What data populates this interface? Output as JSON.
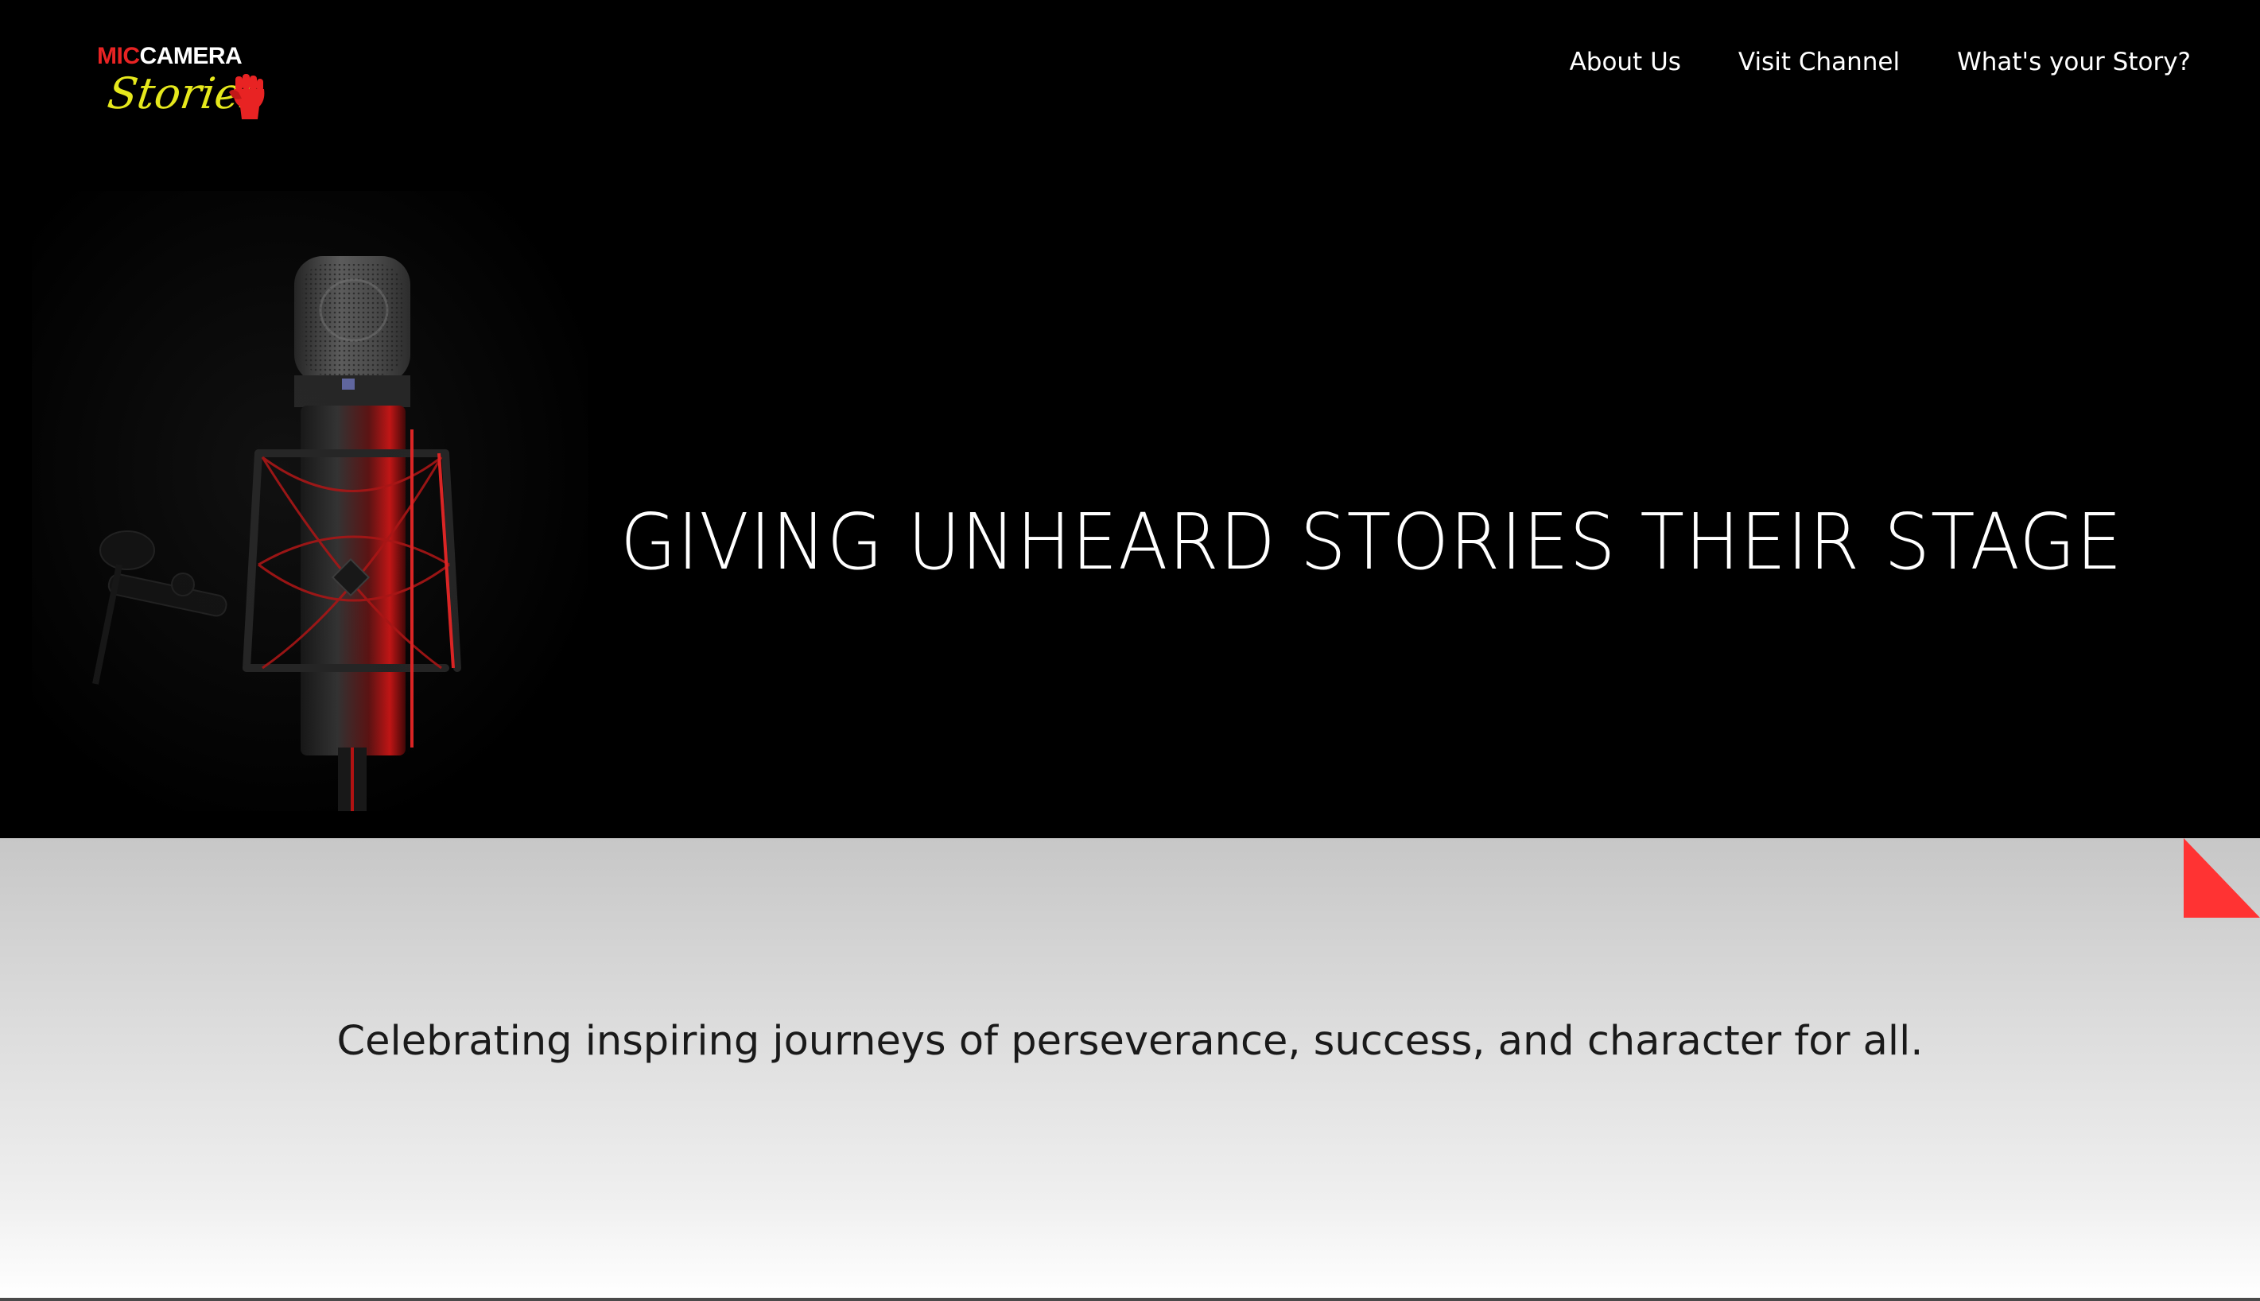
{
  "header": {
    "logo": {
      "word_mic": "MIC",
      "word_camera": "CAMERA",
      "word_stories": "Stories"
    },
    "nav": [
      {
        "label": "About Us"
      },
      {
        "label": "Visit Channel"
      },
      {
        "label": "What's your Story?"
      }
    ]
  },
  "hero": {
    "headline": "GIVING UNHEARD STORIES THEIR STAGE",
    "image": "studio-microphone-photo"
  },
  "lower": {
    "tagline": "Celebrating inspiring journeys of perseverance, success, and character for all."
  },
  "colors": {
    "logo_red": "#e82323",
    "logo_yellow": "#e6e81c",
    "accent_corner": "#ff3333",
    "hero_bg": "#000000",
    "lower_bg_top": "#c7c7c7",
    "lower_bg_bottom": "#ffffff"
  }
}
